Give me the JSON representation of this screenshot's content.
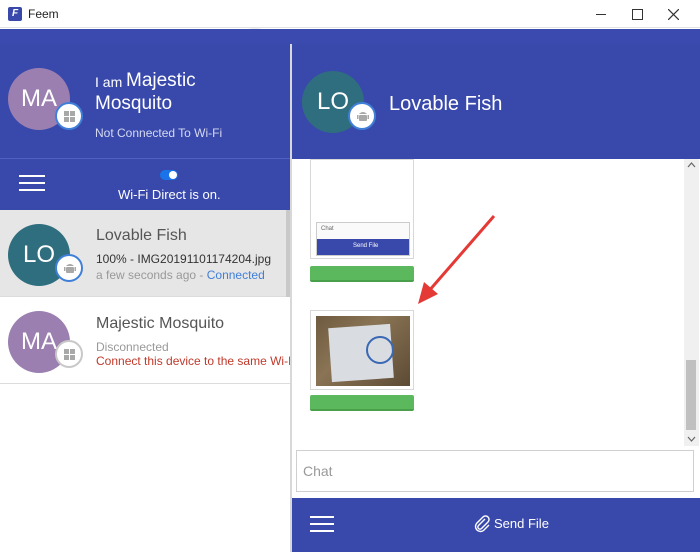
{
  "window": {
    "app_logo": "F",
    "title": "Feem",
    "controls": [
      "minimize-icon",
      "maximize-icon",
      "close-icon"
    ]
  },
  "me": {
    "avatar_initials": "MA",
    "name_prefix": "I am",
    "name_line1": "Majestic",
    "name_line2": "Mosquito",
    "platform_icon": "windows-icon",
    "status": "Not Connected To Wi-Fi",
    "avatar_color": "#9b7fb0"
  },
  "toolbar_left": {
    "menu_icon": "hamburger-icon",
    "wifi_direct_status": "Wi-Fi Direct is on."
  },
  "devices": [
    {
      "initials": "LO",
      "name": "Lovable Fish",
      "platform_icon": "android-icon",
      "transfer": "100% - IMG20191101174204.jpg",
      "time": "a few seconds ago - ",
      "state": "Connected",
      "avatar_color": "#2f6e7e",
      "state_color": "#3f7fd8"
    },
    {
      "initials": "MA",
      "name": "Majestic Mosquito",
      "platform_icon": "windows-icon",
      "state": "Disconnected",
      "hint": "Connect this device to the same Wi-F...",
      "avatar_color": "#9b7fb0",
      "hint_color": "#c0392b"
    }
  ],
  "peer": {
    "initials": "LO",
    "name": "Lovable Fish",
    "platform_icon": "android-icon",
    "avatar_color": "#2f6e7e"
  },
  "transfers": [
    {
      "thumbnail": "screenshot",
      "mini_label": "Chat",
      "mini_send": "Send File",
      "progress": 1.0
    },
    {
      "thumbnail": "photo",
      "progress": 1.0
    }
  ],
  "chat": {
    "placeholder": "Chat"
  },
  "bottom_bar": {
    "menu_icon": "hamburger-icon",
    "send_icon": "paperclip-icon",
    "send_label": "Send File"
  },
  "colors": {
    "primary": "#3949ab",
    "progress": "#5cb85c",
    "arrow": "#e53935"
  }
}
